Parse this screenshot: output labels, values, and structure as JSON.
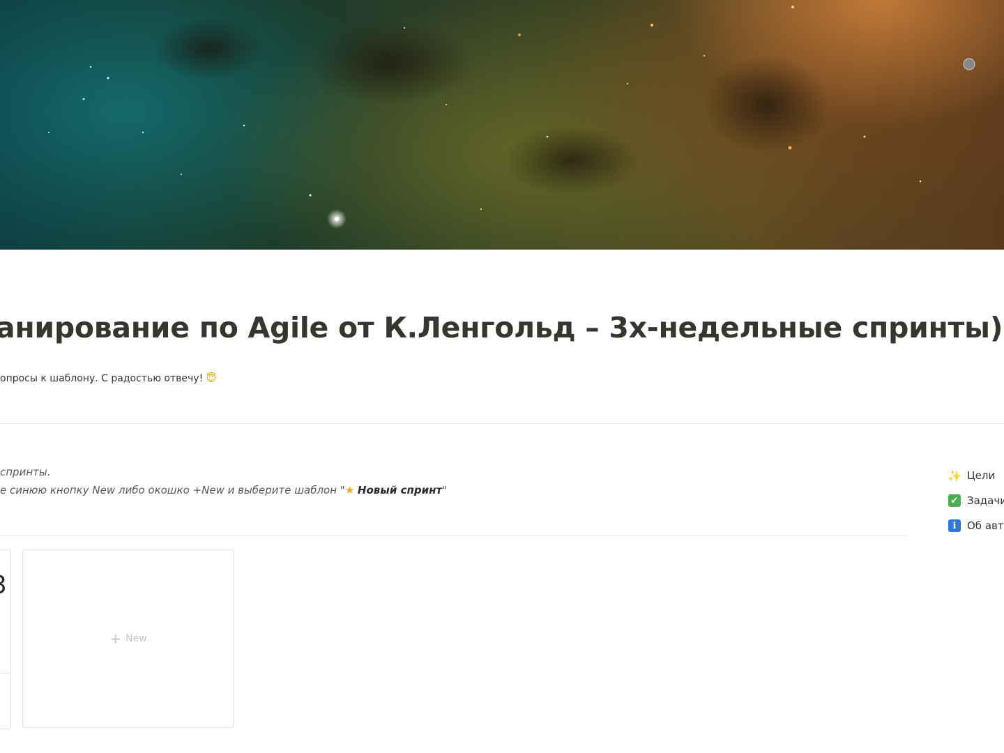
{
  "page": {
    "title": "анирование по Agile от К.Ленгольд – 3х-недельные спринты)",
    "subtitle": "опросы к шаблону. С радостью отвечу!",
    "subtitle_emoji": "😇"
  },
  "callout": {
    "line1": "спринты.",
    "line2_prefix": "е синюю кнопку New либо окошко +New и выберите шаблон \"",
    "line2_star": "★",
    "line2_bold": "Новый спринт",
    "line2_suffix": "\""
  },
  "toc": {
    "items": [
      {
        "icon": "sparkles-icon",
        "glyph": "✨",
        "label": "Цели"
      },
      {
        "icon": "check-box-icon",
        "glyph": "✔",
        "label": "Задачи"
      },
      {
        "icon": "info-icon",
        "glyph": "i",
        "label": "Об авт"
      }
    ]
  },
  "gallery": {
    "card_partial_text": "3",
    "new_label": "New",
    "new_glyph": "+"
  },
  "colors": {
    "text": "#37352f",
    "divider": "#e9e9e7",
    "check_green": "#4caf50",
    "info_blue": "#2f78d6"
  }
}
